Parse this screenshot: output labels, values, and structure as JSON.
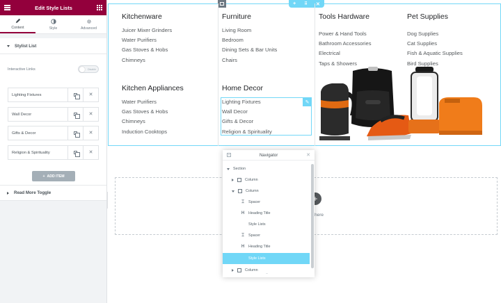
{
  "panel": {
    "title": "Edit Style Lists",
    "tabs": [
      {
        "label": "Content",
        "icon": "pencil-icon",
        "active": true
      },
      {
        "label": "Style",
        "icon": "contrast-icon",
        "active": false
      },
      {
        "label": "Advanced",
        "icon": "gear-icon",
        "active": false
      }
    ],
    "stylist_section": "Stylist List",
    "interactive_links_label": "Interactive Links",
    "interactive_links_toggle": "Disable",
    "items": [
      "Lighting Fixtures",
      "Wall Decor",
      "Gifts & Decor",
      "Religion & Spirituality"
    ],
    "add_item_label": "ADD ITEM",
    "read_more_section": "Read More Toggle"
  },
  "menu": {
    "kitchenware": {
      "heading": "Kitchenware",
      "items": [
        "Juicer Mixer Grinders",
        "Water Purifiers",
        "Gas Stoves & Hobs",
        "Chimneys"
      ]
    },
    "kitchen_appliances": {
      "heading": "Kitchen Appliances",
      "items": [
        "Water Purifiers",
        "Gas Stoves & Hobs",
        "Chimneys",
        "Induction Cooktops"
      ]
    },
    "furniture": {
      "heading": "Furniture",
      "items": [
        "Living Room",
        "Bedroom",
        "Dining Sets & Bar Units",
        "Chairs"
      ]
    },
    "home_decor": {
      "heading": "Home Decor",
      "items": [
        "Lighting Fixtures",
        "Wall Decor",
        "Gifts & Decor",
        "Religion & Spirituality"
      ]
    },
    "tools_hardware": {
      "heading": "Tools Hardware",
      "items": [
        "Power & Hand Tools",
        "Bathroom Accessories",
        "Electrical",
        "Taps & Showers"
      ]
    },
    "pet_supplies": {
      "heading": "Pet Supplies",
      "items": [
        "Dog Supplies",
        "Cat Supplies",
        "Fish & Aquatic Supplies",
        "Bird Supplies"
      ]
    }
  },
  "drop_zone": {
    "text": "here"
  },
  "navigator": {
    "title": "Navigator",
    "rows": [
      {
        "label": "Section",
        "icon": "caret-down"
      },
      {
        "label": "Column",
        "icon": "column-icon"
      },
      {
        "label": "Column",
        "icon": "column-icon"
      },
      {
        "label": "Spacer",
        "icon": "spacer-icon"
      },
      {
        "label": "Heading Title",
        "icon": "heading-icon"
      },
      {
        "label": "Style Lists",
        "icon": "list-icon"
      },
      {
        "label": "Spacer",
        "icon": "spacer-icon"
      },
      {
        "label": "Heading Title",
        "icon": "heading-icon"
      },
      {
        "label": "Style Lists",
        "icon": "list-icon",
        "selected": true
      },
      {
        "label": "Column",
        "icon": "column-icon"
      }
    ]
  },
  "colors": {
    "brand": "#93003c",
    "selection": "#71d7f7"
  }
}
